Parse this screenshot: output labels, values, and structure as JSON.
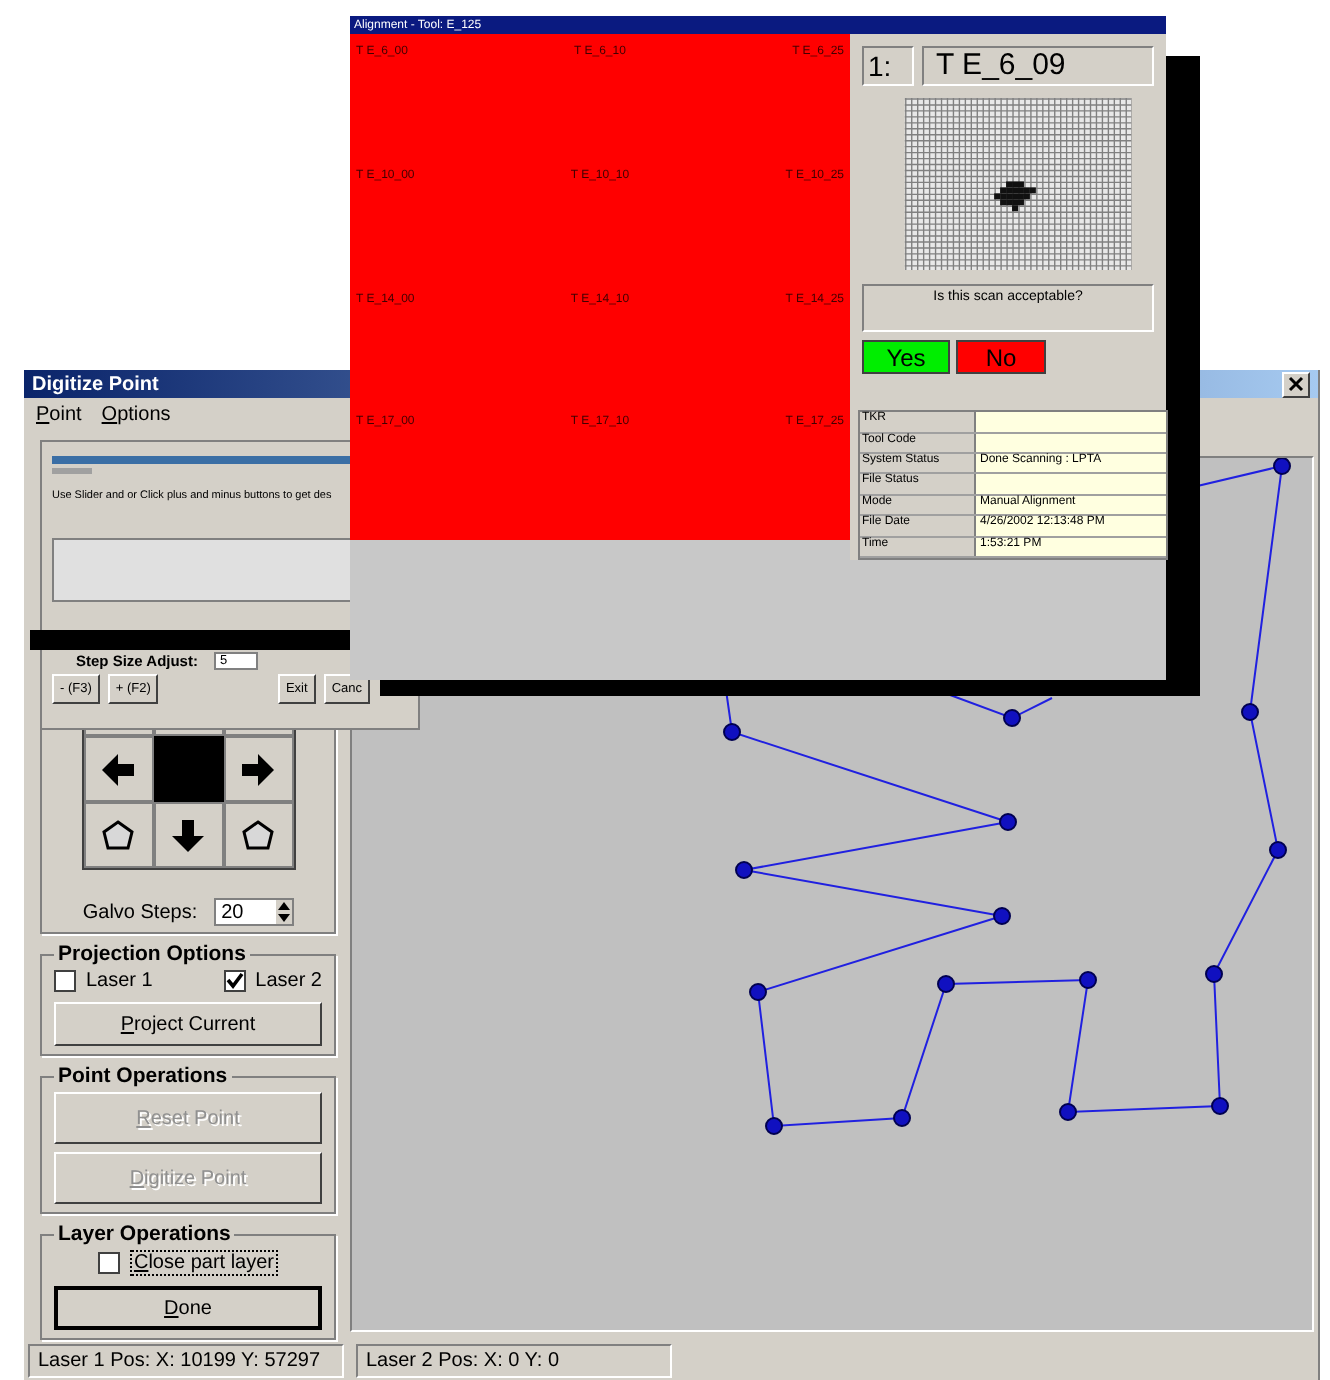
{
  "main_window": {
    "title": "Digitize Point",
    "menu": [
      "Point",
      "Options"
    ],
    "galvo_steps": {
      "label": "Galvo Steps:",
      "value": "20"
    },
    "projection_options": {
      "title": "Projection Options",
      "checkboxes": [
        {
          "label": "Laser 1",
          "checked": false
        },
        {
          "label": "Laser 2",
          "checked": true
        }
      ],
      "button": "Project Current"
    },
    "point_operations": {
      "title": "Point Operations",
      "buttons": [
        {
          "label": "Reset Point",
          "disabled": true
        },
        {
          "label": "Digitize Point",
          "disabled": true
        }
      ]
    },
    "layer_operations": {
      "title": "Layer Operations",
      "checkbox": {
        "label": "Close part layer",
        "checked": false
      },
      "button": "Done"
    },
    "status_bar": [
      "Laser 1 Pos: X: 10199 Y: 57297",
      "Laser 2 Pos: X: 0 Y: 0"
    ]
  },
  "step_dialog": {
    "instruction": "Use Slider and or Click plus and minus buttons to get des",
    "step_size_label": "Step Size Adjust:",
    "step_size_value": "5",
    "buttons": [
      "- (F3)",
      "+ (F2)",
      "Exit",
      "Canc"
    ]
  },
  "alignment_window": {
    "title": "Alignment - Tool: E_125",
    "grid_labels": [
      "T E_6_00",
      "T E_6_10",
      "T E_6_25",
      "T E_10_00",
      "T E_10_10",
      "T E_10_25",
      "T E_14_00",
      "T E_14_10",
      "T E_14_25",
      "T E_17_00",
      "T E_17_10",
      "T E_17_25"
    ],
    "scan_index": "1:",
    "scan_name": "T E_6_09",
    "prompt": "Is this scan acceptable?",
    "buttons": [
      {
        "label": "Yes",
        "kind": "accept"
      },
      {
        "label": "No",
        "kind": "reject"
      }
    ],
    "info": [
      {
        "label": "TKR"
      },
      {
        "label": "Tool Code"
      },
      {
        "label": "System Status",
        "value": "Done Scanning : LPTA"
      },
      {
        "label": "File Status"
      },
      {
        "label": "Mode",
        "value": "Manual Alignment"
      },
      {
        "label": "File Date",
        "value": "4/26/2002 12:13:48 PM"
      },
      {
        "label": "Time",
        "value": "1:53:21 PM"
      }
    ]
  }
}
